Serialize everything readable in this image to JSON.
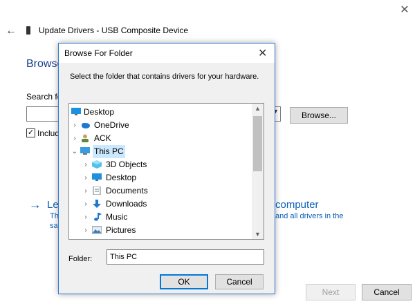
{
  "wizard": {
    "title": "Update Drivers - USB Composite Device",
    "browse_heading": "Browse",
    "search_label": "Search fo",
    "browse_button": "Browse...",
    "include_label": "Includ",
    "link_main_left": "Le",
    "link_main_right": "computer",
    "link_sub1_left": "Th",
    "link_sub1_right": "and all drivers in the",
    "link_sub2_left": "sa",
    "next_button": "Next",
    "cancel_button": "Cancel"
  },
  "dialog": {
    "title": "Browse For Folder",
    "instruction": "Select the folder that contains drivers for your hardware.",
    "tree": [
      {
        "label": "Desktop",
        "icon": "desktop-icon",
        "expanded": null,
        "selected": false
      },
      {
        "label": "OneDrive",
        "icon": "cloud-icon",
        "expanded": false,
        "selected": false
      },
      {
        "label": "ACK",
        "icon": "user-icon",
        "expanded": false,
        "selected": false
      },
      {
        "label": "This PC",
        "icon": "computer-icon",
        "expanded": true,
        "selected": true
      },
      {
        "label": "3D Objects",
        "icon": "cube-icon",
        "expanded": false,
        "selected": false
      },
      {
        "label": "Desktop",
        "icon": "desktop-icon",
        "expanded": false,
        "selected": false
      },
      {
        "label": "Documents",
        "icon": "document-icon",
        "expanded": false,
        "selected": false
      },
      {
        "label": "Downloads",
        "icon": "download-icon",
        "expanded": false,
        "selected": false
      },
      {
        "label": "Music",
        "icon": "music-icon",
        "expanded": false,
        "selected": false
      },
      {
        "label": "Pictures",
        "icon": "picture-icon",
        "expanded": false,
        "selected": false
      }
    ],
    "folder_label": "Folder:",
    "folder_value": "This PC",
    "ok_button": "OK",
    "cancel_button": "Cancel"
  },
  "colors": {
    "accent": "#0078d7",
    "link": "#0a5fb5",
    "selection": "#cce8ff"
  }
}
